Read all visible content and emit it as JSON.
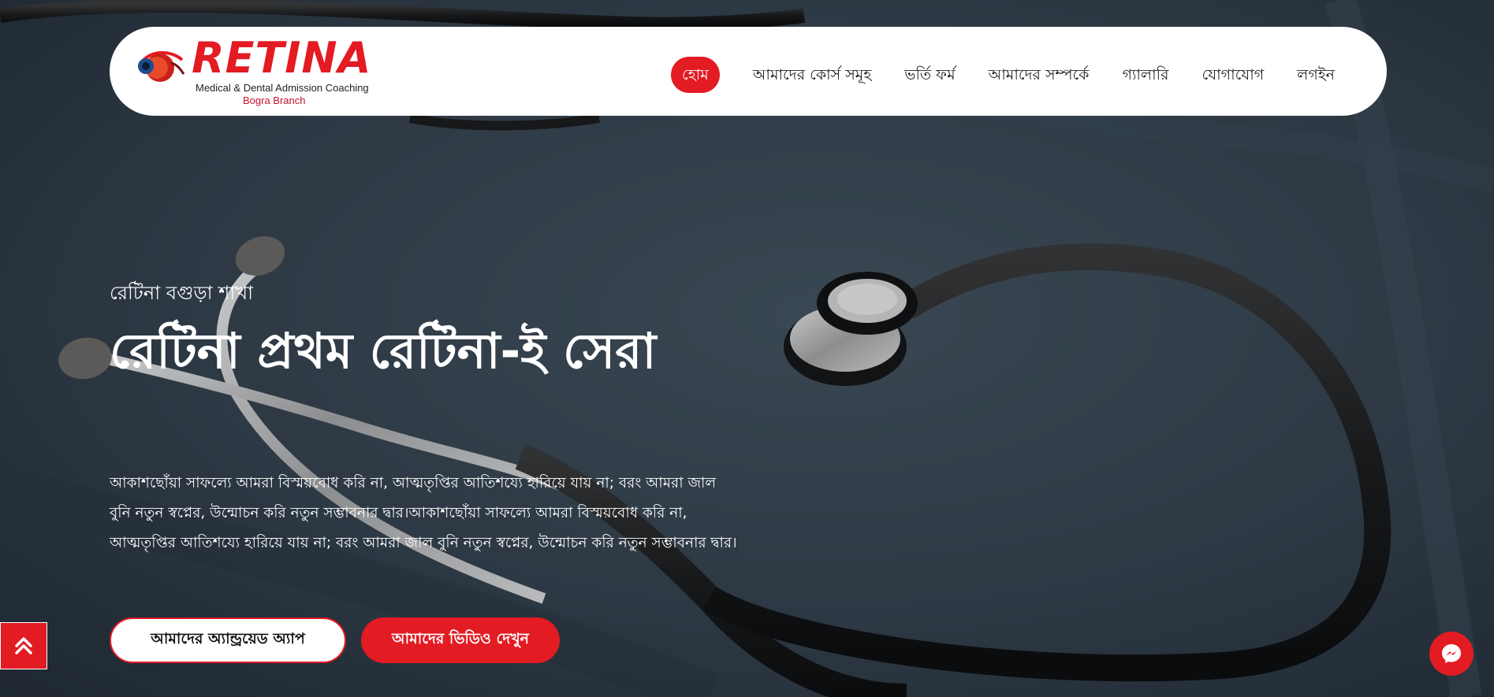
{
  "brand": {
    "name": "RETINA",
    "tagline": "Medical & Dental Admission Coaching",
    "branch": "Bogra Branch",
    "accent_color": "#e31b23"
  },
  "nav": {
    "items": [
      {
        "label": "হোম",
        "active": true
      },
      {
        "label": "আমাদের কোর্স সমূহ"
      },
      {
        "label": "ভর্তি ফর্ম"
      },
      {
        "label": "আমাদের সম্পর্কে"
      },
      {
        "label": "গ্যালারি"
      },
      {
        "label": "যোগাযোগ"
      },
      {
        "label": "লগইন"
      }
    ]
  },
  "hero": {
    "eyebrow": "রেটিনা বগুড়া শাখা",
    "headline": "রেটিনা প্রথম রেটিনা-ই সেরা",
    "description": "আকাশছোঁয়া সাফল্যে আমরা বিস্ময়বোধ করি না, আত্মতৃপ্তির আতিশয্যে হারিয়ে যায় না; বরং আমরা জাল বুনি নতুন স্বপ্নের, উন্মোচন করি নতুন সম্ভাবনার দ্বার।আকাশছোঁয়া সাফল্যে আমরা বিস্ময়বোধ করি না, আত্মতৃপ্তির আতিশয্যে হারিয়ে যায় না; বরং আমরা জাল বুনি নতুন স্বপ্নের, উন্মোচন করি নতুন সম্ভাবনার দ্বার।",
    "buttons": {
      "app": "আমাদের অ্যান্ড্রয়েড অ্যাপ",
      "video": "আমাদের ভিডিও দেখুন"
    },
    "background": "stethoscope-photo"
  },
  "floating": {
    "scroll_top_icon": "double-chevron-up-icon",
    "chat_icon": "messenger-icon"
  }
}
